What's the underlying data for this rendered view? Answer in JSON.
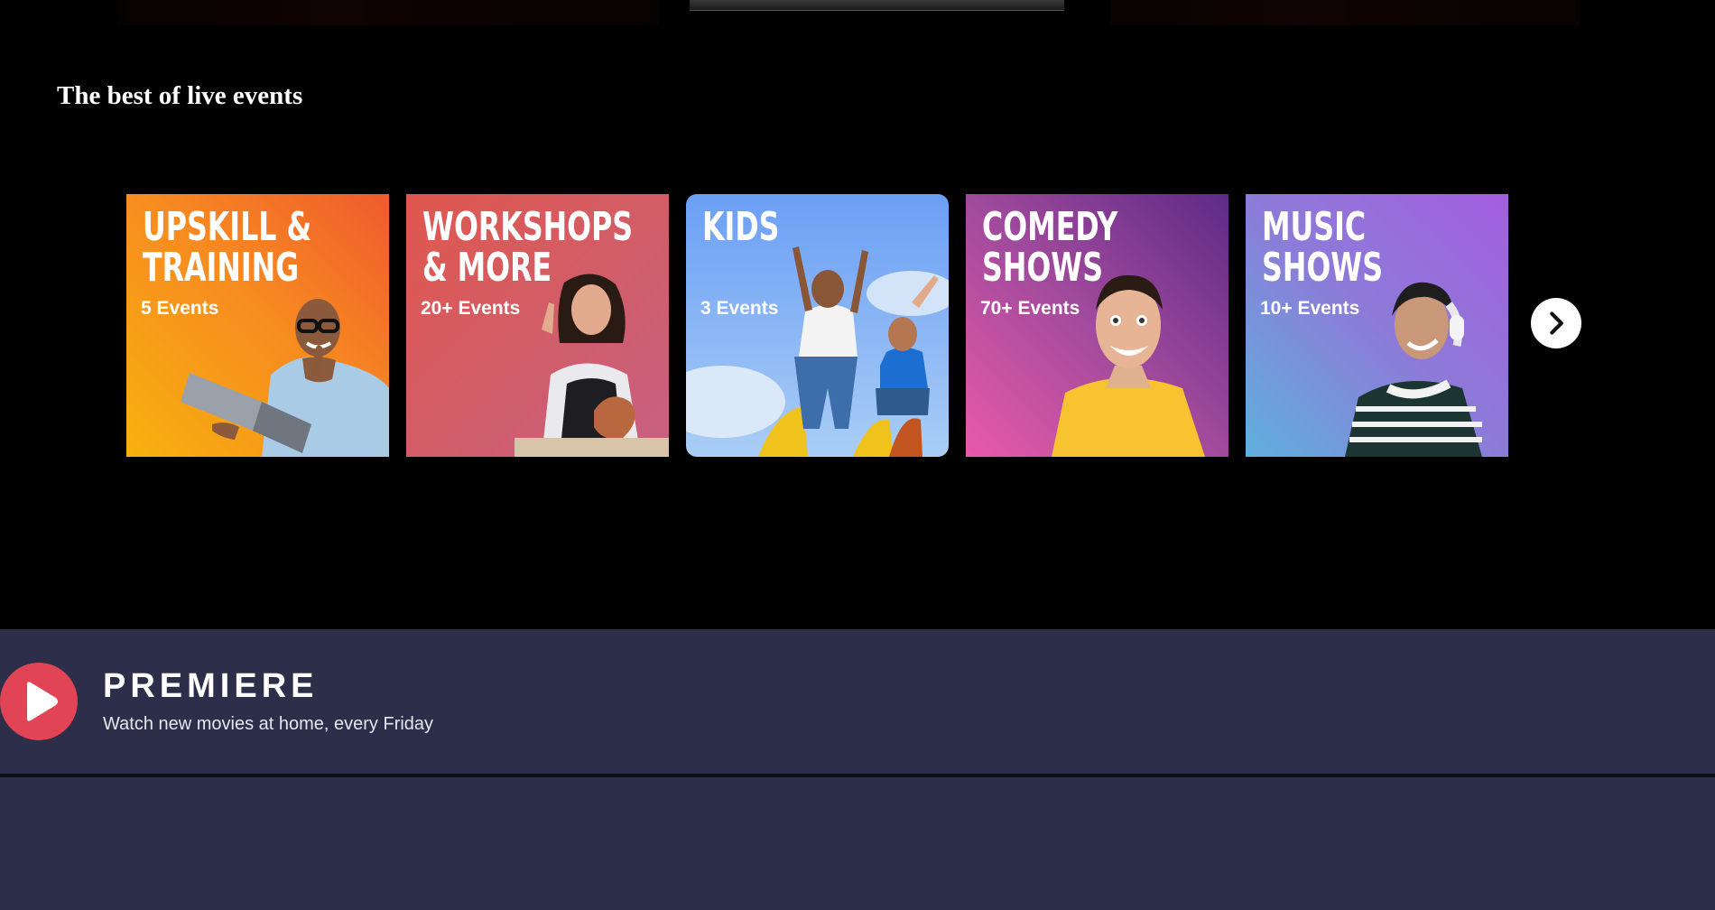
{
  "section": {
    "title": "The best of live events"
  },
  "categories": [
    {
      "title_line1": "UPSKILL &",
      "title_line2": "TRAINING",
      "count": "5 Events",
      "icon": "laptop-man-photo"
    },
    {
      "title_line1": "WORKSHOPS",
      "title_line2": "& MORE",
      "count": "20+ Events",
      "icon": "pottery-woman-photo"
    },
    {
      "title_line1": "KIDS",
      "title_line2": "",
      "count": "3 Events",
      "icon": "kids-slide-photo"
    },
    {
      "title_line1": "COMEDY",
      "title_line2": "SHOWS",
      "count": "70+ Events",
      "icon": "smiling-man-photo"
    },
    {
      "title_line1": "MUSIC",
      "title_line2": "SHOWS",
      "count": "10+ Events",
      "icon": "headphones-woman-photo"
    }
  ],
  "carousel": {
    "next_icon": "chevron-right-icon"
  },
  "premiere": {
    "brand": "PREMIERE",
    "tagline": "Watch new movies at home, every Friday",
    "logo_icon": "play-icon",
    "background": "#2c2e4a",
    "logo_color": "#e04455"
  }
}
